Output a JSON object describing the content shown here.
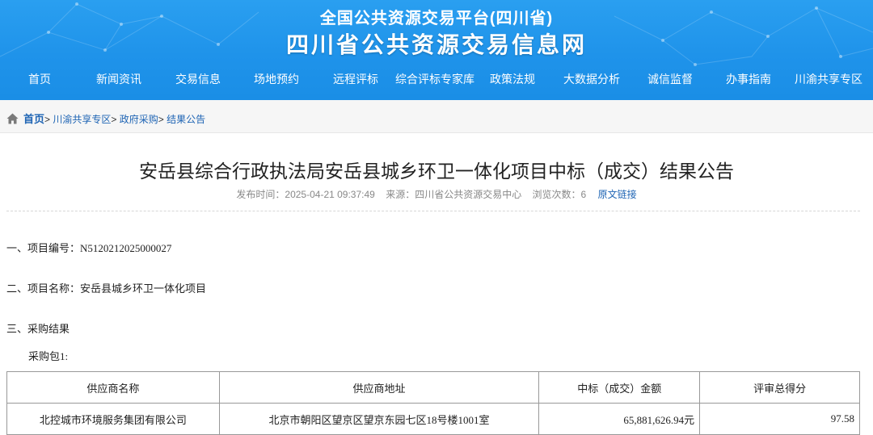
{
  "header": {
    "sub_title": "全国公共资源交易平台(四川省)",
    "main_title": "四川省公共资源交易信息网"
  },
  "nav": {
    "items": [
      "首页",
      "新闻资讯",
      "交易信息",
      "场地预约",
      "远程评标",
      "综合评标专家库",
      "政策法规",
      "大数据分析",
      "诚信监督",
      "办事指南",
      "川渝共享专区"
    ]
  },
  "breadcrumb": {
    "home": "首页",
    "items": [
      "川渝共享专区",
      "政府采购",
      "结果公告"
    ],
    "separator": ">"
  },
  "article": {
    "title": "安岳县综合行政执法局安岳县城乡环卫一体化项目中标（成交）结果公告",
    "publish_time": "发布时间：2025-04-21 09:37:49",
    "source": "来源：四川省公共资源交易中心",
    "views": "浏览次数：6",
    "original_link": "原文链接"
  },
  "content": {
    "s1": "一、项目编号：N5120212025000027",
    "s2": "二、项目名称：安岳县城乡环卫一体化项目",
    "s3": "三、采购结果",
    "package": "采购包1:"
  },
  "table": {
    "headers": [
      "供应商名称",
      "供应商地址",
      "中标（成交）金额",
      "评审总得分"
    ],
    "rows": [
      [
        "北控城市环境服务集团有限公司",
        "北京市朝阳区望京区望京东园七区18号楼1001室",
        "65,881,626.94元",
        "97.58"
      ]
    ]
  },
  "colors": {
    "header_blue": "#1f93ea",
    "link_blue": "#1e64b4",
    "crumb_bg": "#f6f6f6"
  },
  "icons": [
    "home-icon"
  ]
}
